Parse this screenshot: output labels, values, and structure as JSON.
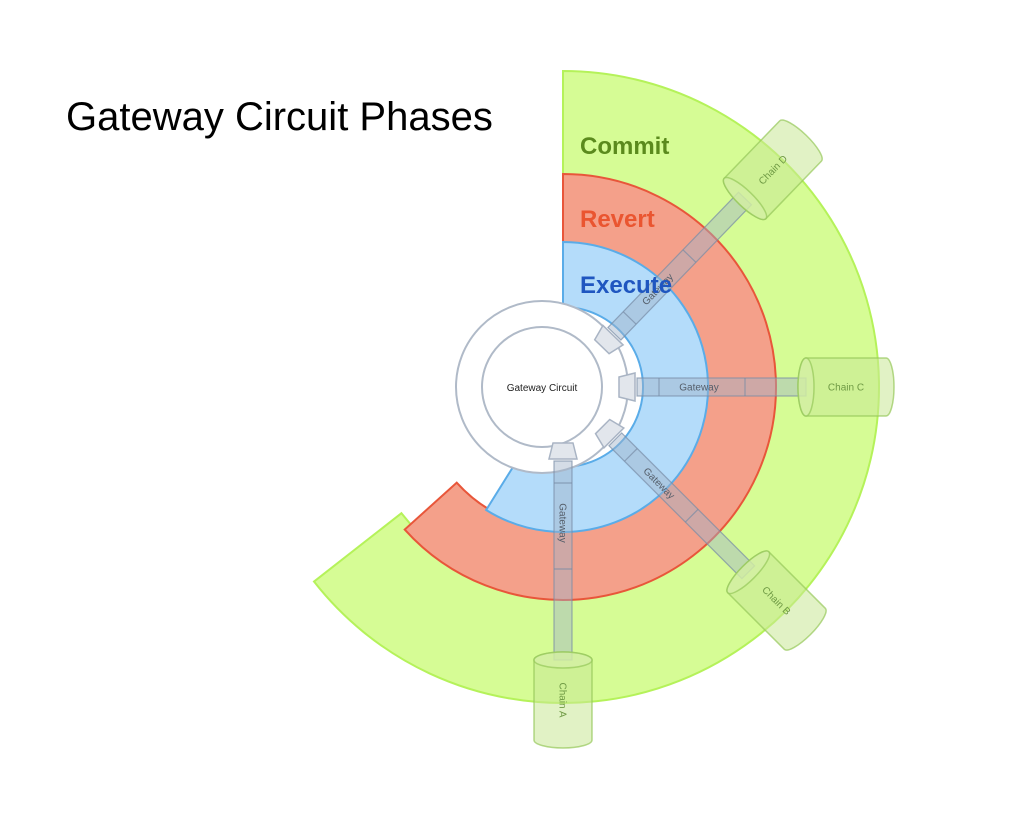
{
  "title": "Gateway Circuit Phases",
  "center": {
    "label": "Gateway Circuit"
  },
  "phases": [
    {
      "label": "Commit",
      "color": "#d6fc95",
      "stroke": "#b5f25a",
      "text_color": "#5b8a1d"
    },
    {
      "label": "Revert",
      "color": "#f4a08a",
      "stroke": "#e8563a",
      "text_color": "#ea5530"
    },
    {
      "label": "Execute",
      "color": "#b4dcfa",
      "stroke": "#5aace8",
      "text_color": "#1f56c0"
    }
  ],
  "connectors": [
    {
      "gateway": "Gateway",
      "chain": "Chain D"
    },
    {
      "gateway": "Gateway",
      "chain": "Chain C"
    },
    {
      "gateway": "Gateway",
      "chain": "Chain B"
    },
    {
      "gateway": "Gateway",
      "chain": "Chain A"
    }
  ]
}
